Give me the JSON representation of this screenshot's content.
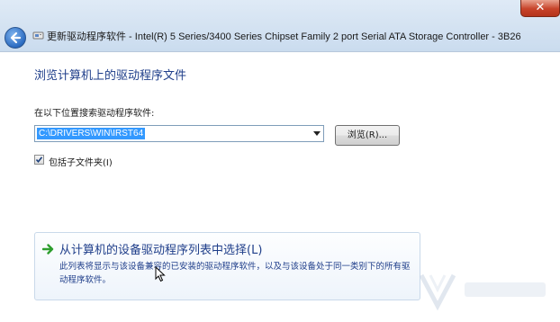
{
  "window": {
    "title": "更新驱动程序软件 - Intel(R) 5 Series/3400 Series Chipset Family 2 port Serial ATA Storage Controller - 3B26",
    "close_label": "✕"
  },
  "page": {
    "heading": "浏览计算机上的驱动程序文件",
    "search_label": "在以下位置搜索驱动程序软件:",
    "path_value": "C:\\DRIVERS\\WIN\\IRST64",
    "browse_label": "浏览(R)...",
    "include_subfolders_label": "包括子文件夹(I)",
    "include_subfolders_checked": true
  },
  "command_link": {
    "title": "从计算机的设备驱动程序列表中选择(L)",
    "description": "此列表将显示与该设备兼容的已安装的驱动程序软件，以及与该设备处于同一类别下的所有驱动程序软件。"
  },
  "colors": {
    "heading": "#1f3e8a",
    "selection": "#3399ff",
    "accent_arrow": "#2e9e2e"
  },
  "icons": {
    "back": "back-arrow-icon",
    "title": "device-icon",
    "command": "green-arrow-icon",
    "checkbox": "checkmark-icon"
  }
}
